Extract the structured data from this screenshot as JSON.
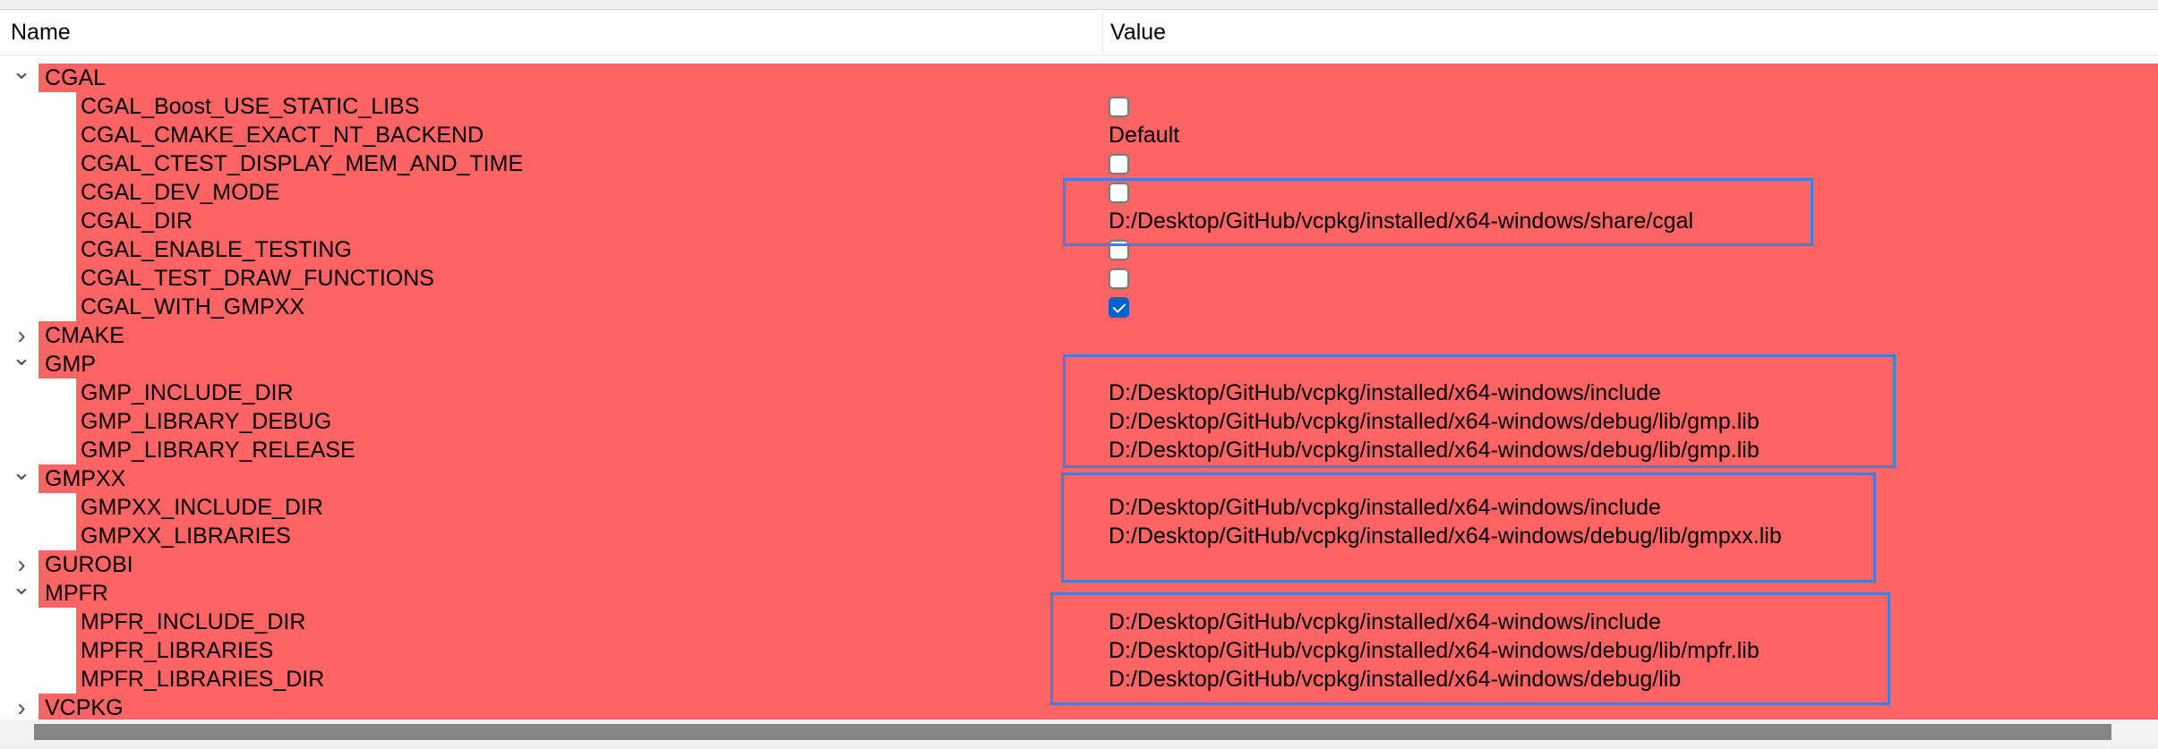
{
  "header": {
    "name_col": "Name",
    "value_col": "Value"
  },
  "rows": [
    {
      "kind": "group",
      "expanded": true,
      "name": "CGAL"
    },
    {
      "kind": "child",
      "name": "CGAL_Boost_USE_STATIC_LIBS",
      "type": "checkbox",
      "checked": false
    },
    {
      "kind": "child",
      "name": "CGAL_CMAKE_EXACT_NT_BACKEND",
      "type": "text",
      "value": "Default"
    },
    {
      "kind": "child",
      "name": "CGAL_CTEST_DISPLAY_MEM_AND_TIME",
      "type": "checkbox",
      "checked": false
    },
    {
      "kind": "child",
      "name": "CGAL_DEV_MODE",
      "type": "checkbox",
      "checked": false
    },
    {
      "kind": "child",
      "name": "CGAL_DIR",
      "type": "text",
      "value": "D:/Desktop/GitHub/vcpkg/installed/x64-windows/share/cgal"
    },
    {
      "kind": "child",
      "name": "CGAL_ENABLE_TESTING",
      "type": "checkbox",
      "checked": false
    },
    {
      "kind": "child",
      "name": "CGAL_TEST_DRAW_FUNCTIONS",
      "type": "checkbox",
      "checked": false
    },
    {
      "kind": "child",
      "name": "CGAL_WITH_GMPXX",
      "type": "checkbox",
      "checked": true
    },
    {
      "kind": "group",
      "expanded": false,
      "name": "CMAKE"
    },
    {
      "kind": "group",
      "expanded": true,
      "name": "GMP"
    },
    {
      "kind": "child",
      "name": "GMP_INCLUDE_DIR",
      "type": "text",
      "value": "D:/Desktop/GitHub/vcpkg/installed/x64-windows/include"
    },
    {
      "kind": "child",
      "name": "GMP_LIBRARY_DEBUG",
      "type": "text",
      "value": "D:/Desktop/GitHub/vcpkg/installed/x64-windows/debug/lib/gmp.lib"
    },
    {
      "kind": "child",
      "name": "GMP_LIBRARY_RELEASE",
      "type": "text",
      "value": "D:/Desktop/GitHub/vcpkg/installed/x64-windows/debug/lib/gmp.lib"
    },
    {
      "kind": "group",
      "expanded": true,
      "name": "GMPXX"
    },
    {
      "kind": "child",
      "name": "GMPXX_INCLUDE_DIR",
      "type": "text",
      "value": "D:/Desktop/GitHub/vcpkg/installed/x64-windows/include"
    },
    {
      "kind": "child",
      "name": "GMPXX_LIBRARIES",
      "type": "text",
      "value": "D:/Desktop/GitHub/vcpkg/installed/x64-windows/debug/lib/gmpxx.lib"
    },
    {
      "kind": "group",
      "expanded": false,
      "name": "GUROBI"
    },
    {
      "kind": "group",
      "expanded": true,
      "name": "MPFR"
    },
    {
      "kind": "child",
      "name": "MPFR_INCLUDE_DIR",
      "type": "text",
      "value": "D:/Desktop/GitHub/vcpkg/installed/x64-windows/include"
    },
    {
      "kind": "child",
      "name": "MPFR_LIBRARIES",
      "type": "text",
      "value": "D:/Desktop/GitHub/vcpkg/installed/x64-windows/debug/lib/mpfr.lib"
    },
    {
      "kind": "child",
      "name": "MPFR_LIBRARIES_DIR",
      "type": "text",
      "value": "D:/Desktop/GitHub/vcpkg/installed/x64-windows/debug/lib"
    },
    {
      "kind": "group",
      "expanded": false,
      "name": "VCPKG"
    }
  ],
  "colors": {
    "row_highlight": "#ff6464",
    "annotation_box": "#3d7fdd",
    "checkbox_checked": "#0062cc"
  },
  "icons": {
    "expanded": "chevron-down-icon",
    "collapsed": "chevron-right-icon"
  }
}
